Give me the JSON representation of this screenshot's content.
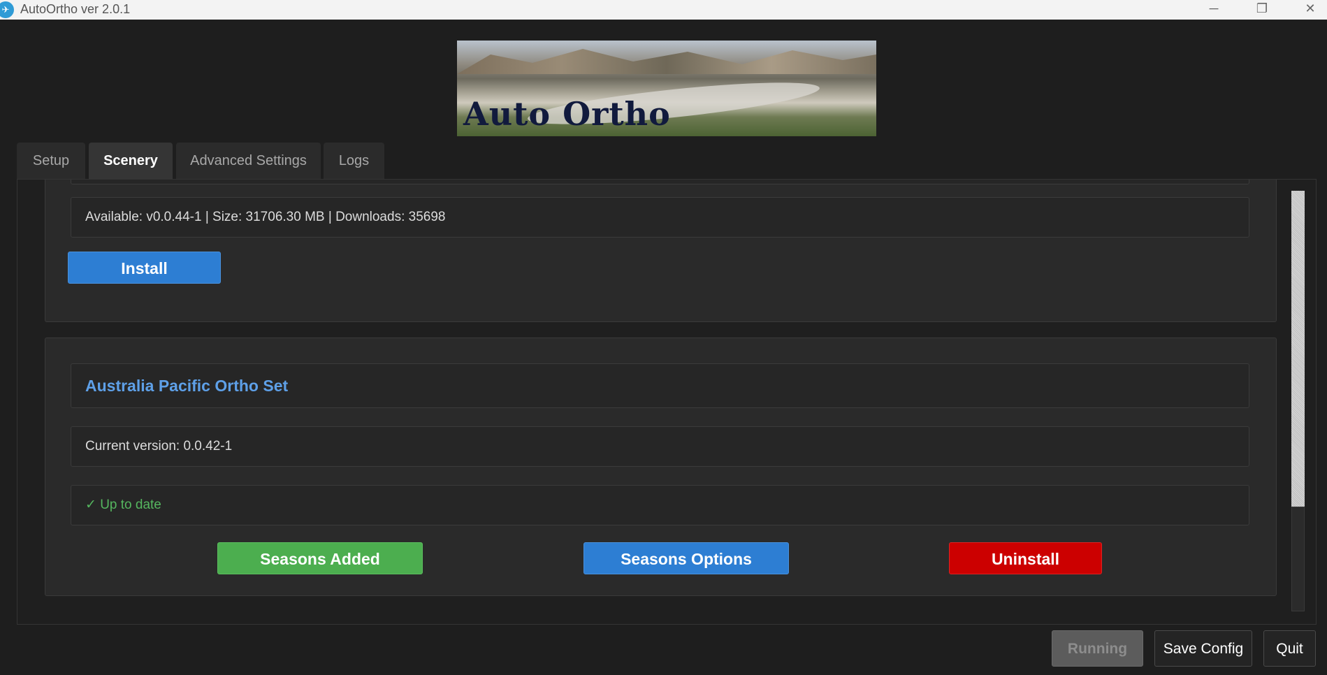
{
  "window": {
    "title": "AutoOrtho ver 2.0.1",
    "controls": {
      "minimize": "─",
      "maximize": "❐",
      "close": "✕"
    }
  },
  "banner": {
    "text": "Auto Ortho"
  },
  "tabs": [
    {
      "label": "Setup",
      "active": false
    },
    {
      "label": "Scenery",
      "active": true
    },
    {
      "label": "Advanced Settings",
      "active": false
    },
    {
      "label": "Logs",
      "active": false
    }
  ],
  "scenery": {
    "previous_set": {
      "available": "Available: v0.0.44-1 | Size: 31706.30 MB | Downloads: 35698",
      "install_label": "Install"
    },
    "australia_set": {
      "title": "Australia Pacific Ortho Set",
      "current_version": "Current version: 0.0.42-1",
      "status": "✓ Up to date",
      "seasons_added_label": "Seasons Added",
      "seasons_options_label": "Seasons Options",
      "uninstall_label": "Uninstall"
    }
  },
  "footer": {
    "running_label": "Running",
    "save_label": "Save Config",
    "quit_label": "Quit"
  },
  "colors": {
    "accent_blue": "#2d7ed3",
    "success_green": "#4cae4f",
    "danger_red": "#cc0000",
    "title_blue": "#5ea0e8"
  }
}
